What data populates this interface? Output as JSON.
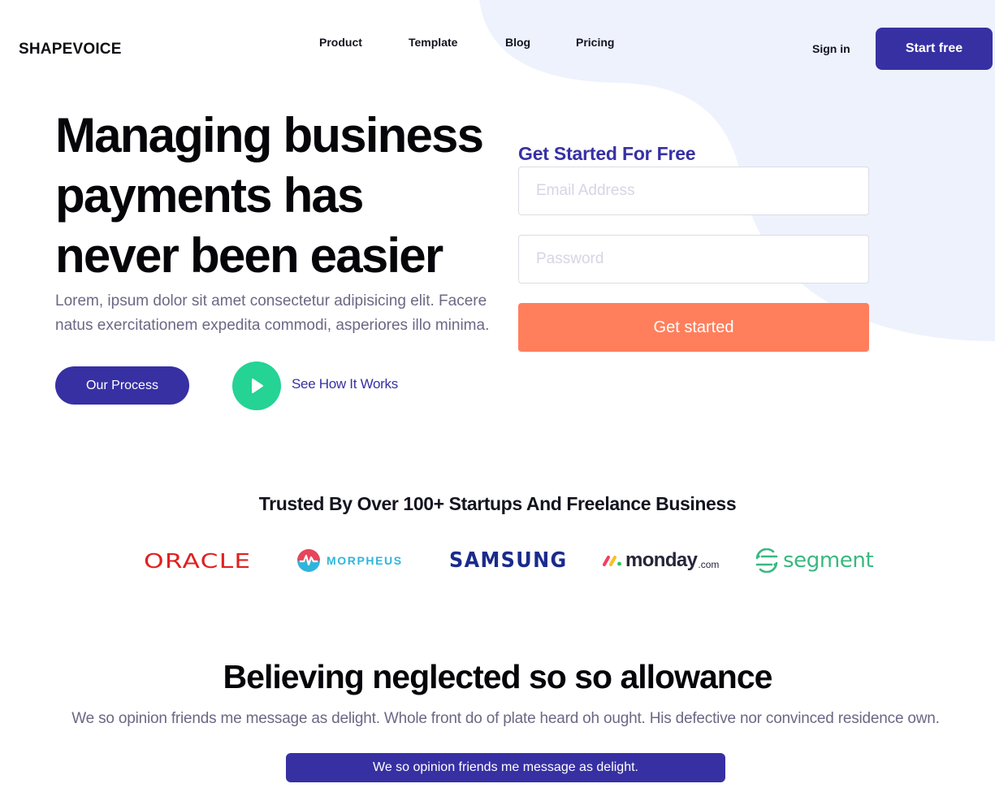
{
  "brand": {
    "name": "SHAPEVOICE"
  },
  "nav": {
    "links": [
      "Product",
      "Template",
      "Blog",
      "Pricing"
    ],
    "signin_label": "Sign in",
    "start_label": "Start free"
  },
  "hero": {
    "title_lines": [
      "Managing business",
      "payments has",
      "never been easier"
    ],
    "subtitle": "Lorem, ipsum dolor sit amet consectetur adipisicing elit. Facere natus exercitationem expedita commodi, asperiores illo minima.",
    "process_label": "Our Process",
    "see_how_label": "See How It Works"
  },
  "form": {
    "title": "Get Started For Free",
    "email_placeholder": "Email Address",
    "email_value": "",
    "password_placeholder": "Password",
    "password_value": "",
    "submit_label": "Get started"
  },
  "trusted": {
    "heading": "Trusted By Over 100+ Startups And Freelance Business",
    "logos": {
      "oracle": "ORACLE",
      "morpheus": "MORPHEUS",
      "samsung": "SAMSUNG",
      "monday": "monday",
      "monday_suffix": ".com",
      "segment": "segment"
    }
  },
  "section": {
    "title": "Believing neglected so so allowance",
    "subtitle": "We so opinion friends me message as delight. Whole front do of plate heard oh ought. His defective nor convinced residence own.",
    "button_label": "We so opinion friends me message as delight."
  },
  "colors": {
    "primary": "#3730a3",
    "accent_orange": "#ff7f5c",
    "play_green": "#25d394",
    "blob": "#eef2fd"
  }
}
